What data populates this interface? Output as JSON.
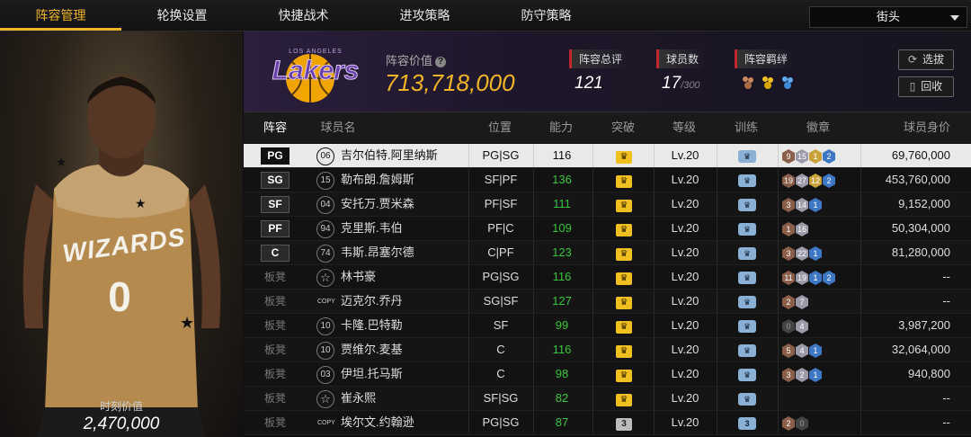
{
  "nav": {
    "tabs": [
      "阵容管理",
      "轮换设置",
      "快捷战术",
      "进攻策略",
      "防守策略"
    ],
    "active_tab": 0,
    "mode_selected": "街头"
  },
  "portrait": {
    "jersey_text": "WIZARDS",
    "jersey_number": "0",
    "value_label": "时刻价值",
    "value": "2,470,000"
  },
  "team": {
    "logo_top_text": "LOS ANGELES",
    "logo_text": "Lakers",
    "value_label": "阵容价值",
    "value": "713,718,000",
    "rating_label": "阵容总评",
    "rating": "121",
    "players_label": "球员数",
    "players_count": "17",
    "players_max": "/300",
    "chem_label": "阵容羁绊",
    "chem_icons": [
      "bronze-chem-icon",
      "gold-chem-icon",
      "blue-chem-icon"
    ],
    "btn_select": "选拔",
    "btn_recycle": "回收"
  },
  "table": {
    "headers": {
      "slot": "阵容",
      "name": "球员名",
      "pos": "位置",
      "ability": "能力",
      "break": "突破",
      "level": "等级",
      "train": "训练",
      "badges": "徽章",
      "price": "球员身价"
    },
    "rows": [
      {
        "slot": "PG",
        "num": "06",
        "name": "吉尔伯特.阿里纳斯",
        "pos": "PG|SG",
        "ability": "116",
        "break": "crown",
        "level": "Lv.20",
        "train": "",
        "badges": [
          [
            "bronze",
            "9"
          ],
          [
            "silver",
            "15"
          ],
          [
            "gold",
            "1"
          ],
          [
            "blue",
            "2"
          ]
        ],
        "price": "69,760,000",
        "selected": true
      },
      {
        "slot": "SG",
        "num": "15",
        "name": "勒布朗.詹姆斯",
        "pos": "SF|PF",
        "ability": "136",
        "break": "crown",
        "level": "Lv.20",
        "train": "",
        "badges": [
          [
            "bronze",
            "19"
          ],
          [
            "silver",
            "27"
          ],
          [
            "gold",
            "12"
          ],
          [
            "blue",
            "2"
          ]
        ],
        "price": "453,760,000"
      },
      {
        "slot": "SF",
        "num": "04",
        "name": "安托万.贾米森",
        "pos": "PF|SF",
        "ability": "111",
        "break": "crown",
        "level": "Lv.20",
        "train": "",
        "badges": [
          [
            "bronze",
            "3"
          ],
          [
            "silver",
            "14"
          ],
          [
            "blue",
            "1"
          ]
        ],
        "price": "9,152,000"
      },
      {
        "slot": "PF",
        "num": "94",
        "name": "克里斯.韦伯",
        "pos": "PF|C",
        "ability": "109",
        "break": "crown",
        "level": "Lv.20",
        "train": "",
        "badges": [
          [
            "bronze",
            "1"
          ],
          [
            "silver",
            "16"
          ]
        ],
        "price": "50,304,000"
      },
      {
        "slot": "C",
        "num": "74",
        "name": "韦斯.昂塞尔德",
        "pos": "C|PF",
        "ability": "123",
        "break": "crown",
        "level": "Lv.20",
        "train": "",
        "badges": [
          [
            "bronze",
            "3"
          ],
          [
            "silver",
            "22"
          ],
          [
            "blue",
            "1"
          ]
        ],
        "price": "81,280,000"
      },
      {
        "slot": "板凳",
        "num": "☆",
        "name": "林书豪",
        "pos": "PG|SG",
        "ability": "116",
        "break": "crown",
        "level": "Lv.20",
        "train": "",
        "badges": [
          [
            "bronze",
            "11"
          ],
          [
            "silver",
            "19"
          ],
          [
            "blue",
            "1"
          ],
          [
            "blue",
            "2"
          ]
        ],
        "price": "--"
      },
      {
        "slot": "板凳",
        "num": "COPY",
        "name": "迈克尔.乔丹",
        "pos": "SG|SF",
        "ability": "127",
        "break": "crown",
        "level": "Lv.20",
        "train": "",
        "badges": [
          [
            "bronze",
            "2"
          ],
          [
            "silver",
            "7"
          ]
        ],
        "price": "--"
      },
      {
        "slot": "板凳",
        "num": "10",
        "name": "卡隆.巴特勒",
        "pos": "SF",
        "ability": "99",
        "break": "crown",
        "level": "Lv.20",
        "train": "",
        "badges": [
          [
            "dark",
            "0"
          ],
          [
            "silver",
            "4"
          ]
        ],
        "price": "3,987,200"
      },
      {
        "slot": "板凳",
        "num": "10",
        "name": "贾维尔.麦基",
        "pos": "C",
        "ability": "116",
        "break": "crown",
        "level": "Lv.20",
        "train": "",
        "badges": [
          [
            "bronze",
            "5"
          ],
          [
            "silver",
            "4"
          ],
          [
            "blue",
            "1"
          ]
        ],
        "price": "32,064,000"
      },
      {
        "slot": "板凳",
        "num": "03",
        "name": "伊坦.托马斯",
        "pos": "C",
        "ability": "98",
        "break": "crown",
        "level": "Lv.20",
        "train": "",
        "badges": [
          [
            "bronze",
            "3"
          ],
          [
            "silver",
            "2"
          ],
          [
            "blue",
            "1"
          ]
        ],
        "price": "940,800"
      },
      {
        "slot": "板凳",
        "num": "☆",
        "name": "崔永熙",
        "pos": "SF|SG",
        "ability": "82",
        "break": "crown",
        "level": "Lv.20",
        "train": "",
        "badges": [],
        "price": "--"
      },
      {
        "slot": "板凳",
        "num": "COPY",
        "name": "埃尔文.约翰逊",
        "pos": "PG|SG",
        "ability": "87",
        "break": "3",
        "level": "Lv.20",
        "train": "3",
        "badges": [
          [
            "bronze",
            "2"
          ],
          [
            "dark",
            "0"
          ]
        ],
        "price": "--"
      }
    ]
  }
}
